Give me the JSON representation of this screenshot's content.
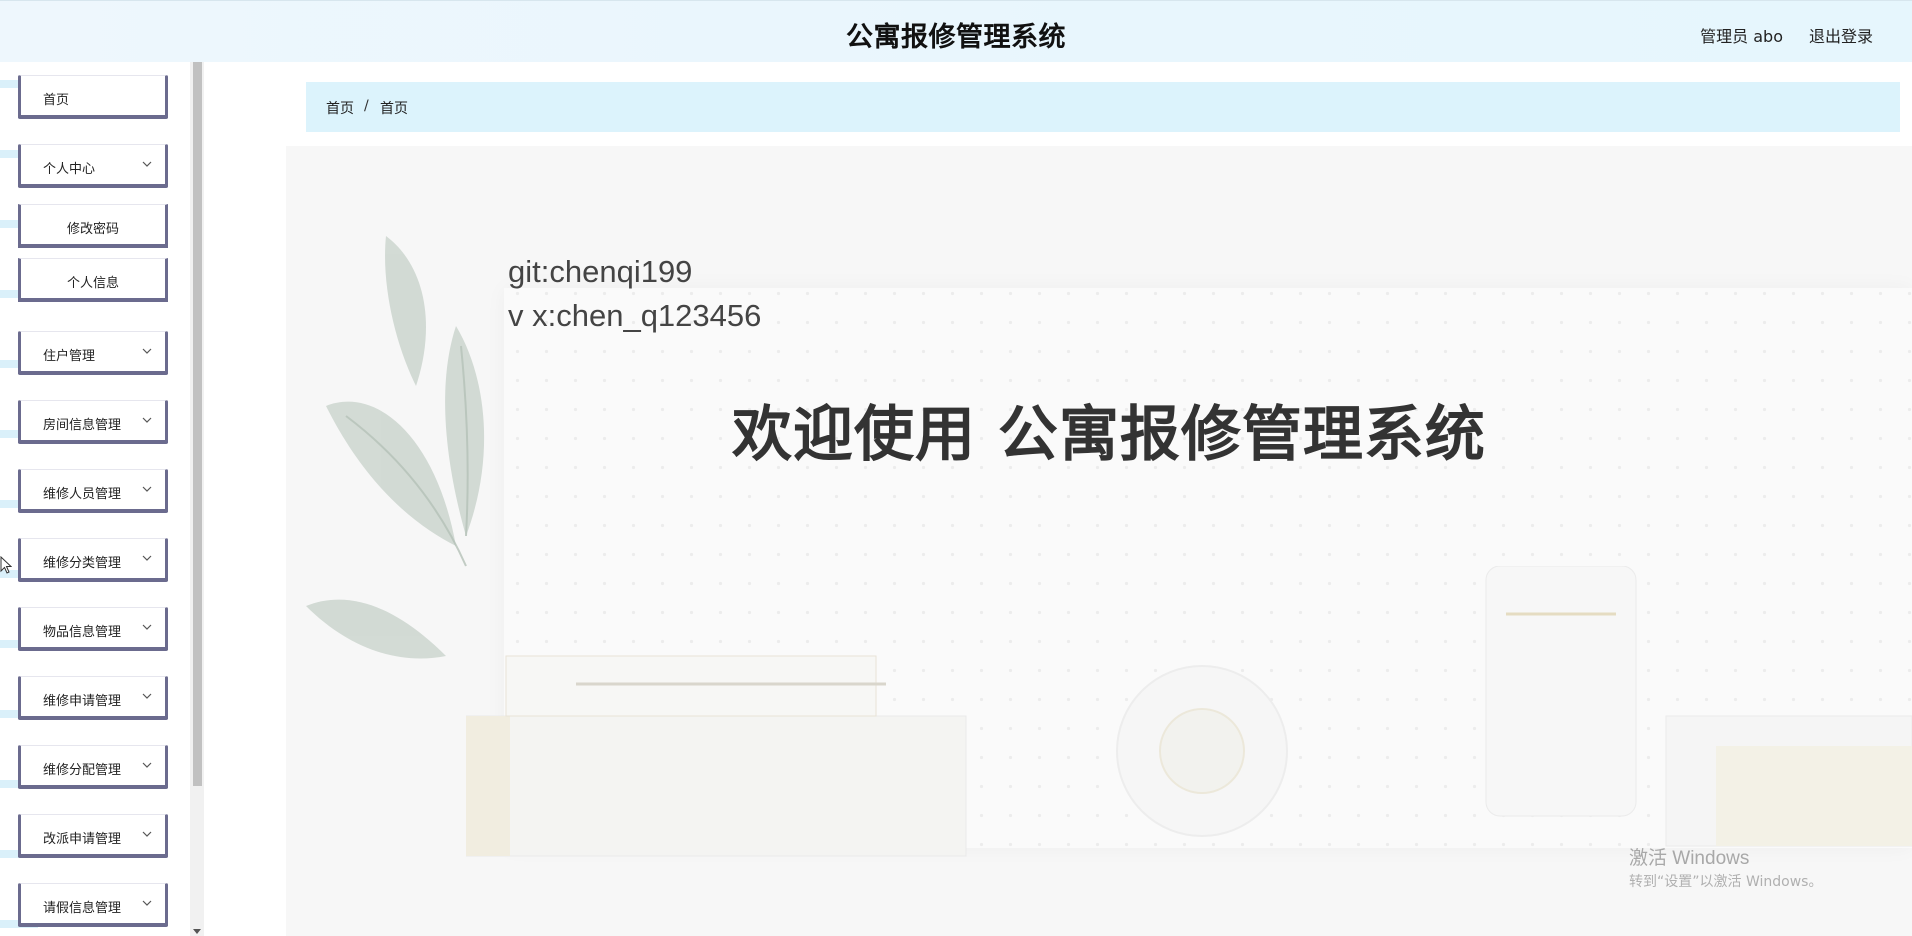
{
  "header": {
    "title": "公寓报修管理系统",
    "user_label": "管理员 abo",
    "logout_label": "退出登录"
  },
  "sidebar": {
    "items": [
      {
        "label": "首页",
        "has_children": false
      },
      {
        "label": "个人中心",
        "has_children": true,
        "children": [
          {
            "label": "修改密码"
          },
          {
            "label": "个人信息"
          }
        ]
      },
      {
        "label": "住户管理",
        "has_children": true
      },
      {
        "label": "房间信息管理",
        "has_children": true
      },
      {
        "label": "维修人员管理",
        "has_children": true
      },
      {
        "label": "维修分类管理",
        "has_children": true
      },
      {
        "label": "物品信息管理",
        "has_children": true
      },
      {
        "label": "维修申请管理",
        "has_children": true
      },
      {
        "label": "维修分配管理",
        "has_children": true
      },
      {
        "label": "改派申请管理",
        "has_children": true
      },
      {
        "label": "请假信息管理",
        "has_children": true
      }
    ]
  },
  "breadcrumb": {
    "home": "首页",
    "separator": "/",
    "current": "首页"
  },
  "hero": {
    "git_text": "git:chenqi199",
    "vx_text": "v x:chen_q123456",
    "welcome_text": "欢迎使用 公寓报修管理系统"
  },
  "watermark": {
    "line1": "激活 Windows",
    "line2": "转到“设置”以激活 Windows。"
  },
  "colors": {
    "header_bg": "#e8f6fd",
    "breadcrumb_bg": "#dcf3fc",
    "menu_border": "#6b6b8e"
  }
}
